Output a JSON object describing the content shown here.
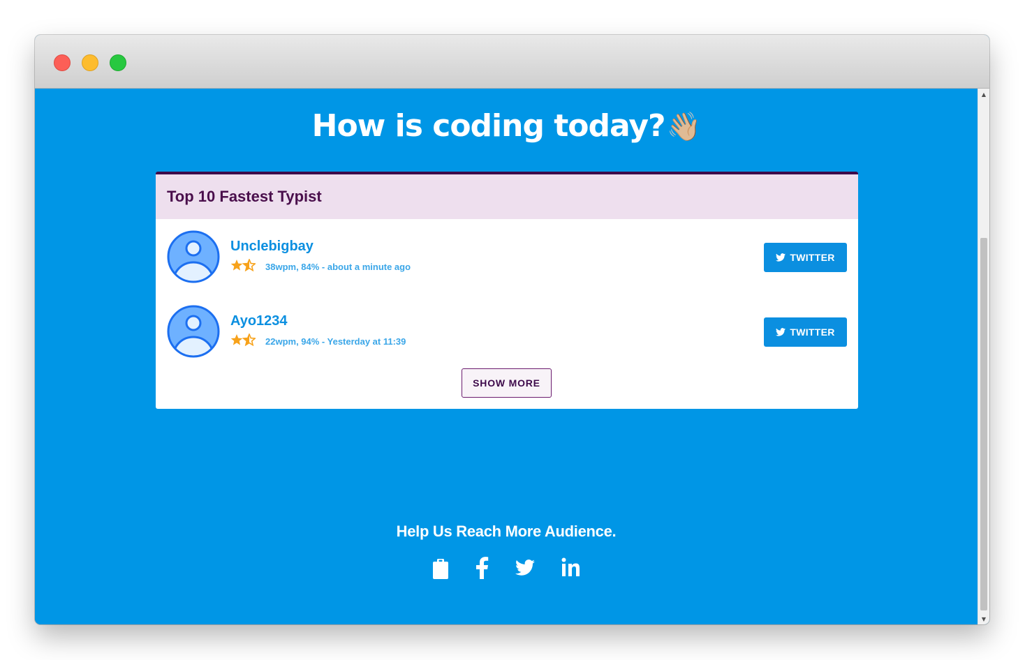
{
  "page": {
    "heading": "How is coding today?",
    "wave_emoji": "👋🏼"
  },
  "leaderboard": {
    "title": "Top 10 Fastest Typist",
    "entries": [
      {
        "name": "Unclebigbay",
        "rating": 1.5,
        "max_rating": 2,
        "stats": "38wpm, 84% - about a minute ago",
        "button_label": "TWITTER"
      },
      {
        "name": "Ayo1234",
        "rating": 1.5,
        "max_rating": 2,
        "stats": "22wpm, 94% - Yesterday at 11:39",
        "button_label": "TWITTER"
      }
    ],
    "show_more_label": "SHOW MORE"
  },
  "footer": {
    "text": "Help Us Reach More Audience.",
    "social_icons": [
      "clipboard-icon",
      "facebook-icon",
      "twitter-icon",
      "linkedin-icon"
    ]
  },
  "colors": {
    "background": "#0096e6",
    "card_header": "#eedfee",
    "accent_purple": "#4a0f4c",
    "link_blue": "#0b8fe0",
    "star": "#f7a21b"
  }
}
